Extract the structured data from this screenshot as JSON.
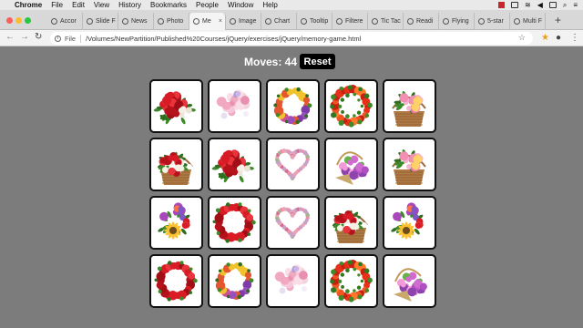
{
  "menubar": {
    "app": "Chrome",
    "items": [
      "File",
      "Edit",
      "View",
      "History",
      "Bookmarks",
      "People",
      "Window",
      "Help"
    ]
  },
  "tabs": [
    {
      "label": "Accor",
      "active": false
    },
    {
      "label": "Slide F",
      "active": false
    },
    {
      "label": "News",
      "active": false
    },
    {
      "label": "Photo",
      "active": false
    },
    {
      "label": "Me",
      "active": true
    },
    {
      "label": "Image",
      "active": false
    },
    {
      "label": "Chart",
      "active": false
    },
    {
      "label": "Tooltip",
      "active": false
    },
    {
      "label": "Filtere",
      "active": false
    },
    {
      "label": "Tic Tac",
      "active": false
    },
    {
      "label": "Readi",
      "active": false
    },
    {
      "label": "Flying",
      "active": false
    },
    {
      "label": "5-star",
      "active": false
    },
    {
      "label": "Multi F",
      "active": false
    }
  ],
  "toolbar": {
    "scheme": "File",
    "url": "/Volumes/NewPartition/Published%20Courses/jQuery/exercises/jQuery/memory-game.html"
  },
  "game": {
    "moves_label": "Moves: 44",
    "reset_label": "Reset"
  },
  "colors": {
    "page_bg": "#7c7c7c",
    "card_border": "#111111",
    "reset_bg": "#000000"
  },
  "cards": [
    [
      "red-roses-bouquet",
      "pink-bouquet",
      "purple-orange-wreath",
      "red-flower-wreath",
      "flower-basket-pink"
    ],
    [
      "flower-basket-red",
      "red-roses-bouquet",
      "heart-wreath",
      "flower-basket-purple",
      "flower-basket-pink"
    ],
    [
      "sunflower-bouquet",
      "red-rose-ring",
      "heart-wreath",
      "flower-basket-red",
      "sunflower-bouquet"
    ],
    [
      "red-rose-ring",
      "purple-orange-wreath",
      "pink-bouquet",
      "red-flower-wreath",
      "flower-basket-purple"
    ]
  ]
}
